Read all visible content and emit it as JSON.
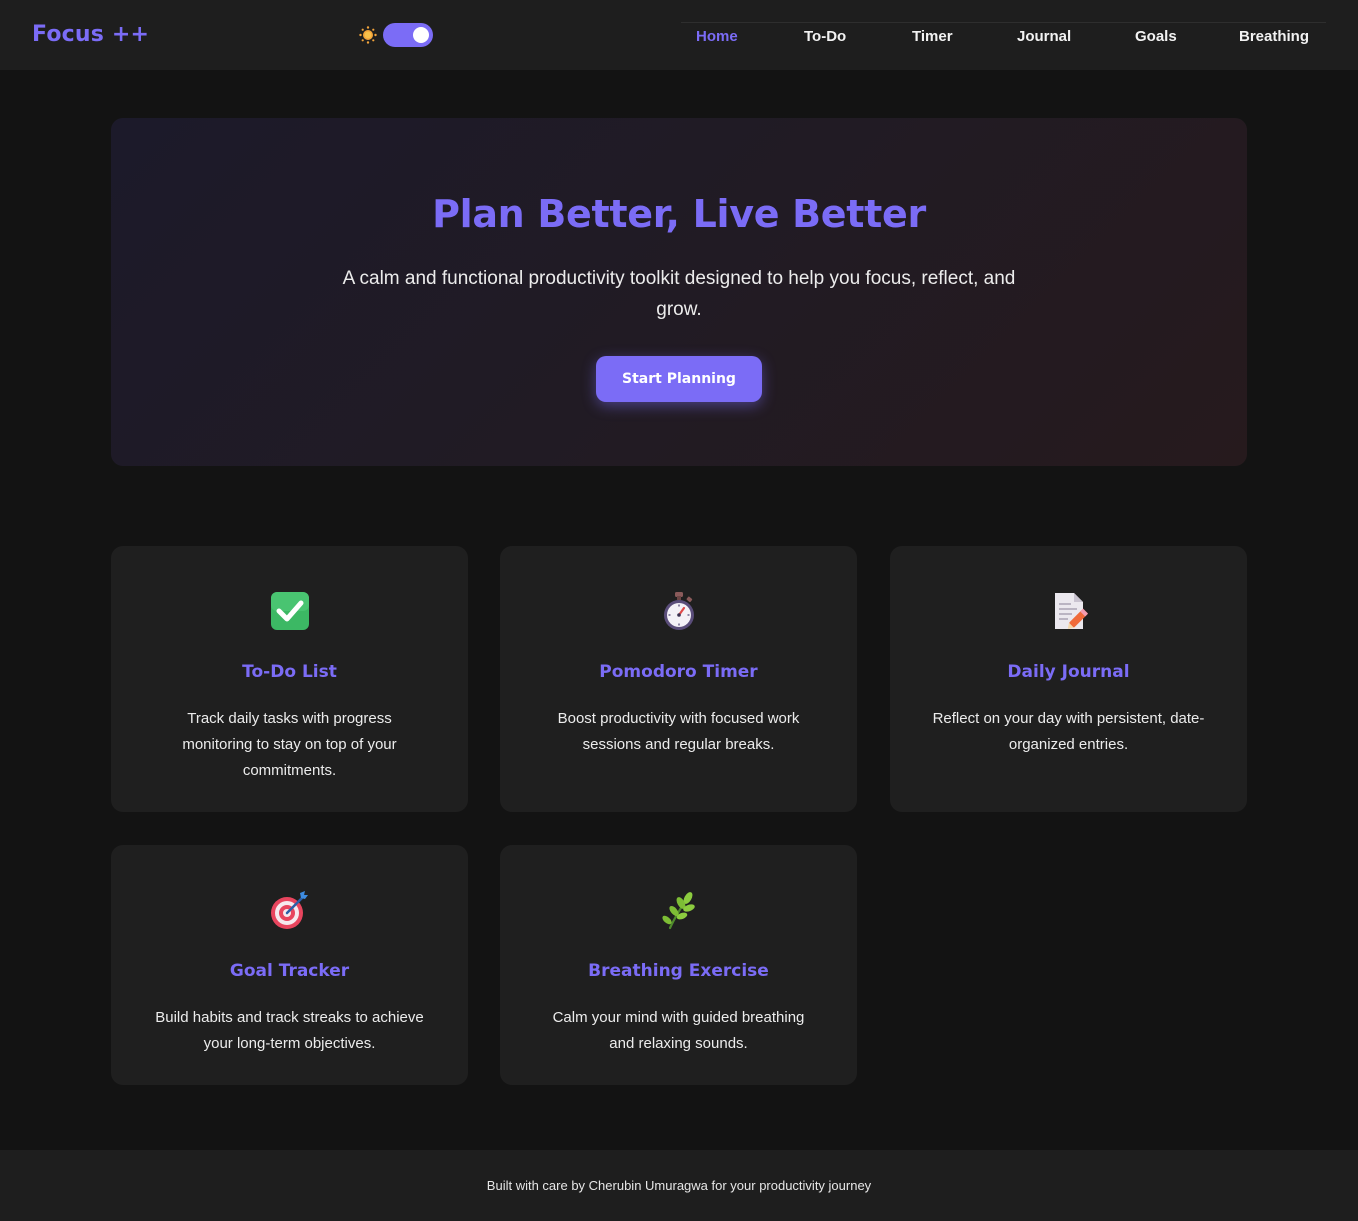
{
  "header": {
    "logo": "Focus ++",
    "theme_toggle": {
      "state": "dark"
    },
    "nav": [
      {
        "label": "Home",
        "active": true
      },
      {
        "label": "To-Do",
        "active": false
      },
      {
        "label": "Timer",
        "active": false
      },
      {
        "label": "Journal",
        "active": false
      },
      {
        "label": "Goals",
        "active": false
      },
      {
        "label": "Breathing",
        "active": false
      }
    ]
  },
  "hero": {
    "title": "Plan Better, Live Better",
    "subtitle": "A calm and functional productivity toolkit designed to help you focus, reflect, and grow.",
    "button": "Start Planning"
  },
  "features": [
    {
      "icon": "checkmark-icon",
      "title": "To-Do List",
      "description": "Track daily tasks with progress monitoring to stay on top of your commitments."
    },
    {
      "icon": "stopwatch-icon",
      "title": "Pomodoro Timer",
      "description": "Boost productivity with focused work sessions and regular breaks."
    },
    {
      "icon": "memo-icon",
      "title": "Daily Journal",
      "description": "Reflect on your day with persistent, date-organized entries."
    },
    {
      "icon": "target-icon",
      "title": "Goal Tracker",
      "description": "Build habits and track streaks to achieve your long-term objectives."
    },
    {
      "icon": "herb-icon",
      "title": "Breathing Exercise",
      "description": "Calm your mind with guided breathing and relaxing sounds."
    }
  ],
  "footer": {
    "text": "Built with care by Cherubin Umuragwa for your productivity journey"
  },
  "colors": {
    "accent": "#7b6cf6",
    "background": "#131313",
    "surface": "#1f1f1f"
  }
}
